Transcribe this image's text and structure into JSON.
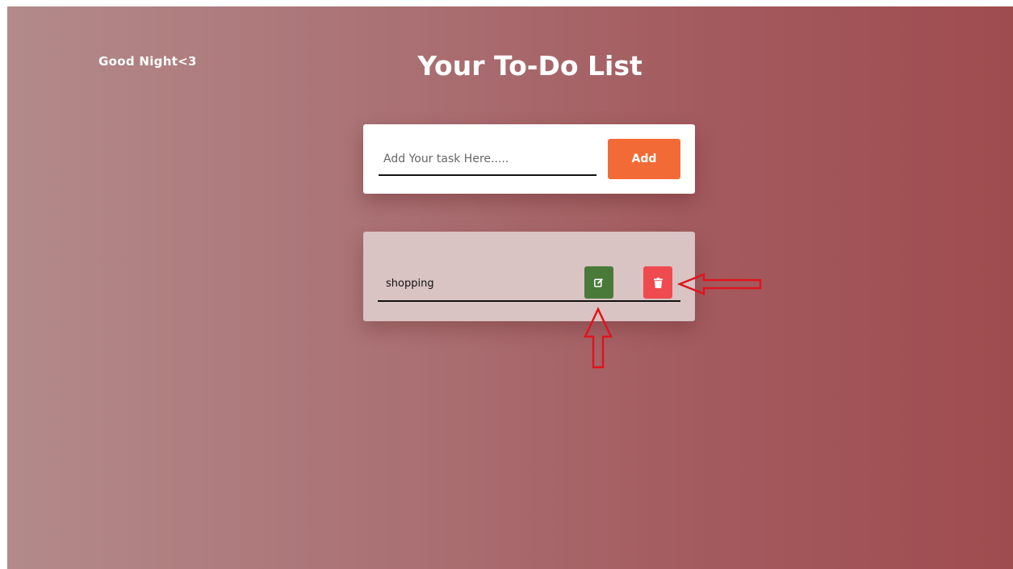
{
  "header": {
    "greeting": "Good  Night<3",
    "title": "Your To-Do List"
  },
  "add_form": {
    "placeholder": "Add Your task Here.....",
    "value": "",
    "add_label": "Add"
  },
  "tasks": [
    {
      "text": "shopping",
      "edit_icon": "edit-icon",
      "delete_icon": "trash-icon"
    }
  ],
  "colors": {
    "add_button": "#f26a36",
    "edit_button": "#4a7a3a",
    "delete_button": "#ef4a4f",
    "annotation_arrow": "#e0141e"
  }
}
